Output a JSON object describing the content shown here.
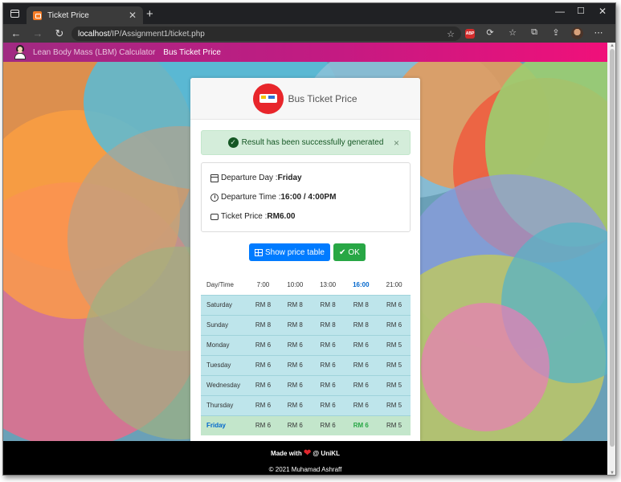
{
  "browser": {
    "tab_title": "Ticket Price",
    "url_host": "localhost",
    "url_path": "/IP/Assignment1/ticket.php",
    "abp_label": "ABP"
  },
  "navbar": {
    "link_lbm": "Lean Body Mass (LBM) Calculator",
    "link_bus": "Bus Ticket Price"
  },
  "card": {
    "title": "Bus Ticket Price",
    "alert": "Result has been successfully generated",
    "alert_close": "×",
    "departure_day_label": "Departure Day : ",
    "departure_day": "Friday",
    "departure_time_label": "Departure Time : ",
    "departure_time": "16:00 / 4:00PM",
    "ticket_price_label": "Ticket Price : ",
    "ticket_price": "RM6.00",
    "show_table_btn": "Show price table",
    "ok_btn": "OK"
  },
  "price_table": {
    "headers": [
      "Day/Time",
      "7:00",
      "10:00",
      "13:00",
      "16:00",
      "21:00"
    ],
    "rows": [
      [
        "Saturday",
        "RM 8",
        "RM 8",
        "RM 8",
        "RM 8",
        "RM 6"
      ],
      [
        "Sunday",
        "RM 8",
        "RM 8",
        "RM 8",
        "RM 8",
        "RM 6"
      ],
      [
        "Monday",
        "RM 6",
        "RM 6",
        "RM 6",
        "RM 6",
        "RM 5"
      ],
      [
        "Tuesday",
        "RM 6",
        "RM 6",
        "RM 6",
        "RM 6",
        "RM 5"
      ],
      [
        "Wednesday",
        "RM 6",
        "RM 6",
        "RM 6",
        "RM 6",
        "RM 5"
      ],
      [
        "Thursday",
        "RM 6",
        "RM 6",
        "RM 6",
        "RM 6",
        "RM 5"
      ],
      [
        "Friday",
        "RM 6",
        "RM 6",
        "RM 6",
        "RM 6",
        "RM 5"
      ]
    ],
    "highlight_day": "Friday",
    "highlight_time": "16:00"
  },
  "footer": {
    "made_with": "Made with",
    "at_unikl": "@ UniKL",
    "copyright": "© 2021 Muhamad Ashraff"
  },
  "colors": {
    "navbar_start": "#a02a82",
    "navbar_end": "#f0107a",
    "alert_bg": "#d4edda",
    "row_bg": "#bee5eb",
    "selected_row_bg": "#c3e6cb",
    "primary": "#007bff",
    "success": "#28a745"
  }
}
